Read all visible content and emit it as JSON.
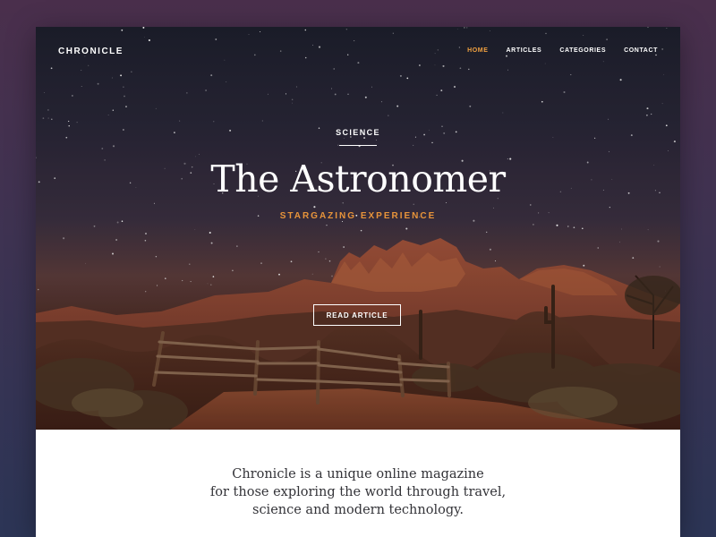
{
  "brand": "CHRONICLE",
  "nav": {
    "items": [
      {
        "label": "HOME",
        "active": true
      },
      {
        "label": "ARTICLES",
        "active": false
      },
      {
        "label": "CATEGORIES",
        "active": false
      },
      {
        "label": "CONTACT",
        "active": false
      }
    ]
  },
  "hero": {
    "category": "SCIENCE",
    "title": "The Astronomer",
    "subtitle": "STARGAZING EXPERIENCE",
    "cta_label": "READ ARTICLE"
  },
  "intro": {
    "lines": [
      "Chronicle is a unique online magazine",
      "for those exploring the world through travel,",
      "science and modern technology."
    ]
  },
  "colors": {
    "accent": "#e8943a",
    "nav_active": "#f0a040",
    "background_top": "#4a2f4c",
    "background_bottom": "#2c3556"
  }
}
